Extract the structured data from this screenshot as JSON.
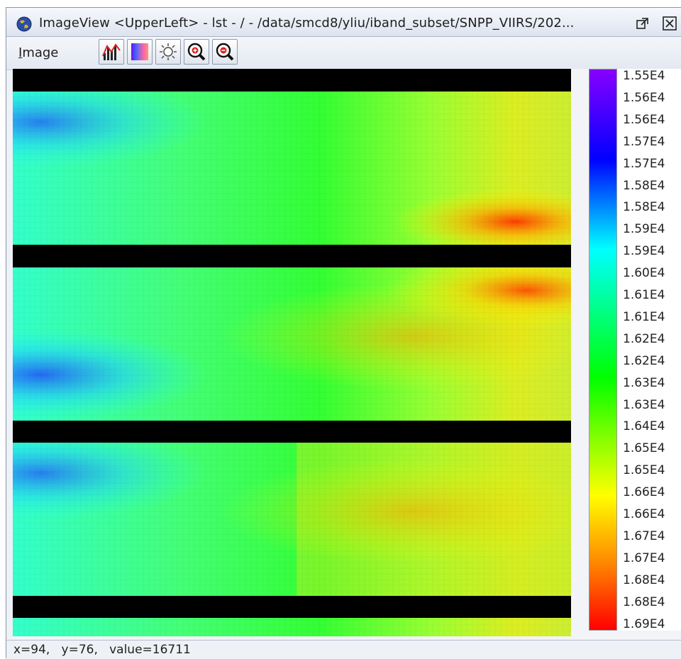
{
  "window": {
    "title": "ImageView <UpperLeft>  - lst  - /  - /data/smcd8/yliu/iband_subset/SNPP_VIIRS/202..."
  },
  "menu": {
    "image_first": "I",
    "image_rest": "mage"
  },
  "toolbar": {
    "tools": [
      "histogram-icon",
      "palette-icon",
      "brightness-icon",
      "zoom-in-icon",
      "zoom-out-icon"
    ]
  },
  "colorbar": {
    "labels": [
      "1.55E4",
      "1.56E4",
      "1.56E4",
      "1.57E4",
      "1.57E4",
      "1.58E4",
      "1.58E4",
      "1.59E4",
      "1.59E4",
      "1.60E4",
      "1.61E4",
      "1.61E4",
      "1.62E4",
      "1.62E4",
      "1.63E4",
      "1.63E4",
      "1.64E4",
      "1.65E4",
      "1.65E4",
      "1.66E4",
      "1.66E4",
      "1.67E4",
      "1.67E4",
      "1.68E4",
      "1.68E4",
      "1.69E4"
    ],
    "palette": [
      "#8800ff",
      "#0000ff",
      "#00ffff",
      "#00ff00",
      "#ffff00",
      "#ff8800",
      "#ff0000"
    ]
  },
  "status": {
    "text": "x=94,   y=76,   value=16711"
  },
  "image": {
    "fill_color": "#000000"
  }
}
